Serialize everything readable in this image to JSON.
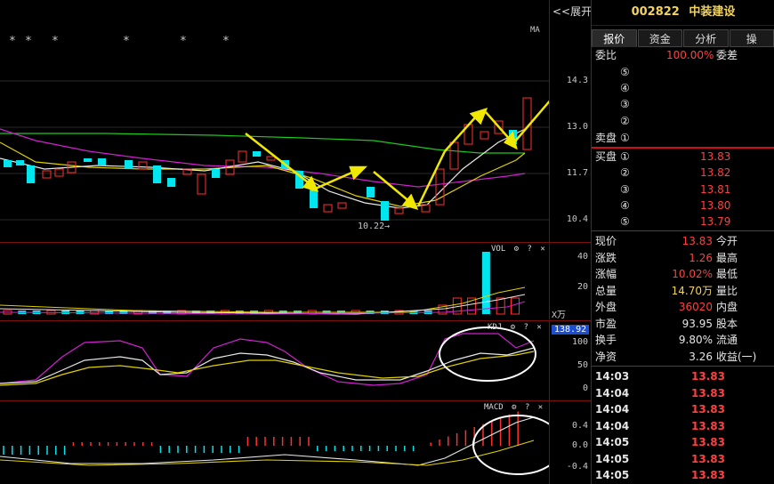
{
  "top_bar": {
    "expand_label": "<<展开"
  },
  "main_panel": {
    "stars": [
      "*",
      "*",
      "*",
      "*",
      "*",
      "*"
    ],
    "ma_label": "MA",
    "low_label": "10.22",
    "price_axis": [
      "14.3",
      "13.0",
      "11.7",
      "10.4"
    ]
  },
  "vol_panel": {
    "label": "VOL",
    "axis": [
      "40",
      "20"
    ],
    "unit": "X万"
  },
  "kdj_panel": {
    "label": "KDJ",
    "axis": [
      "100",
      "50",
      "0"
    ],
    "highlight": "138.92"
  },
  "macd_panel": {
    "label": "MACD",
    "axis": [
      "0.4",
      "0.0",
      "-0.4"
    ]
  },
  "toolbar_icons": {
    "gear": "⚙",
    "help": "?",
    "close": "✕"
  },
  "quote": {
    "code": "002822",
    "name": "中装建设",
    "tabs": [
      "报价",
      "资金",
      "分析",
      "操"
    ],
    "weibi_label": "委比",
    "weibi_value": "100.00%",
    "weicha_label": "委差",
    "sell_label": "卖盘",
    "buy_label": "买盘",
    "sell_levels": [
      "⑤",
      "④",
      "③",
      "②",
      "①"
    ],
    "buy_levels": [
      {
        "idx": "①",
        "price": "13.83"
      },
      {
        "idx": "②",
        "price": "13.82"
      },
      {
        "idx": "③",
        "price": "13.81"
      },
      {
        "idx": "④",
        "price": "13.80"
      },
      {
        "idx": "⑤",
        "price": "13.79"
      }
    ],
    "stats": [
      {
        "l1": "现价",
        "v1": "13.83",
        "c1": "red",
        "l2": "今开"
      },
      {
        "l1": "涨跌",
        "v1": "1.26",
        "c1": "red",
        "l2": "最高"
      },
      {
        "l1": "涨幅",
        "v1": "10.02%",
        "c1": "red",
        "l2": "最低"
      },
      {
        "l1": "总量",
        "v1": "14.70万",
        "c1": "yel",
        "l2": "量比"
      },
      {
        "l1": "外盘",
        "v1": "36020",
        "c1": "red",
        "l2": "内盘"
      },
      {
        "l1": "市盈",
        "v1": "93.95",
        "c1": "wht",
        "l2": "股本"
      },
      {
        "l1": "换手",
        "v1": "9.80%",
        "c1": "wht",
        "l2": "流通"
      },
      {
        "l1": "净资",
        "v1": "3.26",
        "c1": "wht",
        "l2": "收益(一)"
      }
    ],
    "ticks": [
      {
        "time": "14:03",
        "price": "13.83"
      },
      {
        "time": "14:04",
        "price": "13.83"
      },
      {
        "time": "14:04",
        "price": "13.83"
      },
      {
        "time": "14:04",
        "price": "13.83"
      },
      {
        "time": "14:05",
        "price": "13.83"
      },
      {
        "time": "14:05",
        "price": "13.83"
      },
      {
        "time": "14:05",
        "price": "13.83"
      }
    ]
  }
}
